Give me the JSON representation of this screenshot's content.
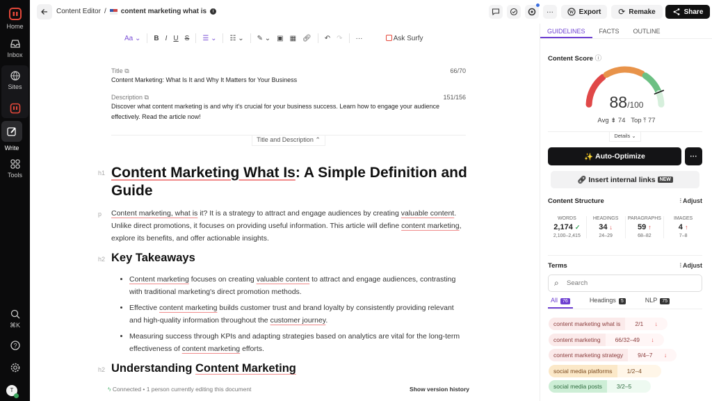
{
  "sidebar": {
    "items": [
      {
        "label": "Home"
      },
      {
        "label": "Inbox"
      },
      {
        "label": "Sites"
      },
      {
        "label": "Write"
      },
      {
        "label": "Tools"
      }
    ],
    "shortcut": "⌘K",
    "avatar": "T"
  },
  "header": {
    "breadcrumb_root": "Content Editor",
    "separator": "/",
    "doc_title": "content marketing what is",
    "export": "Export",
    "remake": "Remake",
    "share": "Share"
  },
  "toolbar": {
    "font": "Aa",
    "ask": "Ask Surfy"
  },
  "meta": {
    "title_label": "Title",
    "title_count": "66/70",
    "title_value": "Content Marketing: What Is It and Why It Matters for Your Business",
    "desc_label": "Description",
    "desc_count": "151/156",
    "desc_value": "Discover what content marketing is and why it's crucial for your business success. Learn how to engage your audience effectively. Read the article now!",
    "toggle": "Title and Description"
  },
  "doc": {
    "h1_tag": "h1",
    "p_tag": "p",
    "h2_tag": "h2",
    "h1": [
      {
        "t": "Content Marketing What Is",
        "u": true
      },
      {
        "t": ": A Simple Definition and Guide",
        "u": false
      }
    ],
    "intro": [
      {
        "t": "Content marketing, what is",
        "u": true
      },
      {
        "t": " it? It is a strategy to attract and engage audiences by creating ",
        "u": false
      },
      {
        "t": "valuable content",
        "u": true
      },
      {
        "t": ". Unlike direct promotions, it focuses on providing useful information. This article will define ",
        "u": false
      },
      {
        "t": "content marketing",
        "u": true
      },
      {
        "t": ", explore its benefits, and offer actionable insights.",
        "u": false
      }
    ],
    "h2a": [
      {
        "t": "Key Takeaways",
        "u": false
      }
    ],
    "bullets": [
      [
        {
          "t": "Content marketing",
          "u": true
        },
        {
          "t": " focuses on creating ",
          "u": false
        },
        {
          "t": "valuable content",
          "u": true
        },
        {
          "t": " to attract and engage audiences, contrasting with traditional marketing's direct promotion methods.",
          "u": false
        }
      ],
      [
        {
          "t": "Effective ",
          "u": false
        },
        {
          "t": "content marketing",
          "u": true
        },
        {
          "t": " builds customer trust and brand loyalty by consistently providing relevant and high-quality information throughout the ",
          "u": false
        },
        {
          "t": "customer journey",
          "u": true
        },
        {
          "t": ".",
          "u": false
        }
      ],
      [
        {
          "t": "Measuring success through KPIs and adapting strategies based on analytics are vital for the long-term effectiveness of ",
          "u": false
        },
        {
          "t": "content marketing",
          "u": true
        },
        {
          "t": " efforts.",
          "u": false
        }
      ]
    ],
    "h2b": [
      {
        "t": "Understanding ",
        "u": false
      },
      {
        "t": "Content Marketing",
        "u": true
      }
    ]
  },
  "footer": {
    "status": "Connected • 1 person currently editing this document",
    "history": "Show version history"
  },
  "panel": {
    "tabs": [
      "GUIDELINES",
      "FACTS",
      "OUTLINE"
    ],
    "score_label": "Content Score",
    "score": 88,
    "score_max": "/100",
    "avg_label": "Avg",
    "avg": "74",
    "top_label": "Top",
    "top": "77",
    "details": "Details",
    "auto": "Auto-Optimize",
    "links": "Insert internal links",
    "new": "NEW",
    "structure_label": "Content Structure",
    "adjust": "Adjust",
    "stats": [
      {
        "k": "WORDS",
        "n": "2,174",
        "s": "✓",
        "c": "#3aa35b",
        "r": "2,100–2,415"
      },
      {
        "k": "HEADINGS",
        "n": "34",
        "s": "↓",
        "c": "#e04848",
        "r": "24–29"
      },
      {
        "k": "PARAGRAPHS",
        "n": "59",
        "s": "↑",
        "c": "#e04848",
        "r": "68–82"
      },
      {
        "k": "IMAGES",
        "n": "4",
        "s": "↑",
        "c": "#e04848",
        "r": "7–8"
      }
    ],
    "terms_label": "Terms",
    "search_placeholder": "Search",
    "term_tabs": [
      {
        "l": "All",
        "n": "76"
      },
      {
        "l": "Headings",
        "n": "5"
      },
      {
        "l": "NLP",
        "n": "75"
      }
    ],
    "terms": [
      {
        "t": "content marketing what is",
        "v": "2/1",
        "a": "↓",
        "s": "red"
      },
      {
        "t": "content marketing",
        "v": "66/32–49",
        "a": "↓",
        "s": "red"
      },
      {
        "t": "content marketing strategy",
        "v": "9/4–7",
        "a": "↓",
        "s": "red"
      },
      {
        "t": "social media platforms",
        "v": "1/2–4",
        "a": "",
        "s": "orange"
      },
      {
        "t": "social media posts",
        "v": "3/2–5",
        "a": "",
        "s": "green"
      }
    ]
  },
  "colors": {
    "accent": "#6d3fd1",
    "red": "#e04848",
    "orange": "#e8934a",
    "green": "#6cc083"
  }
}
